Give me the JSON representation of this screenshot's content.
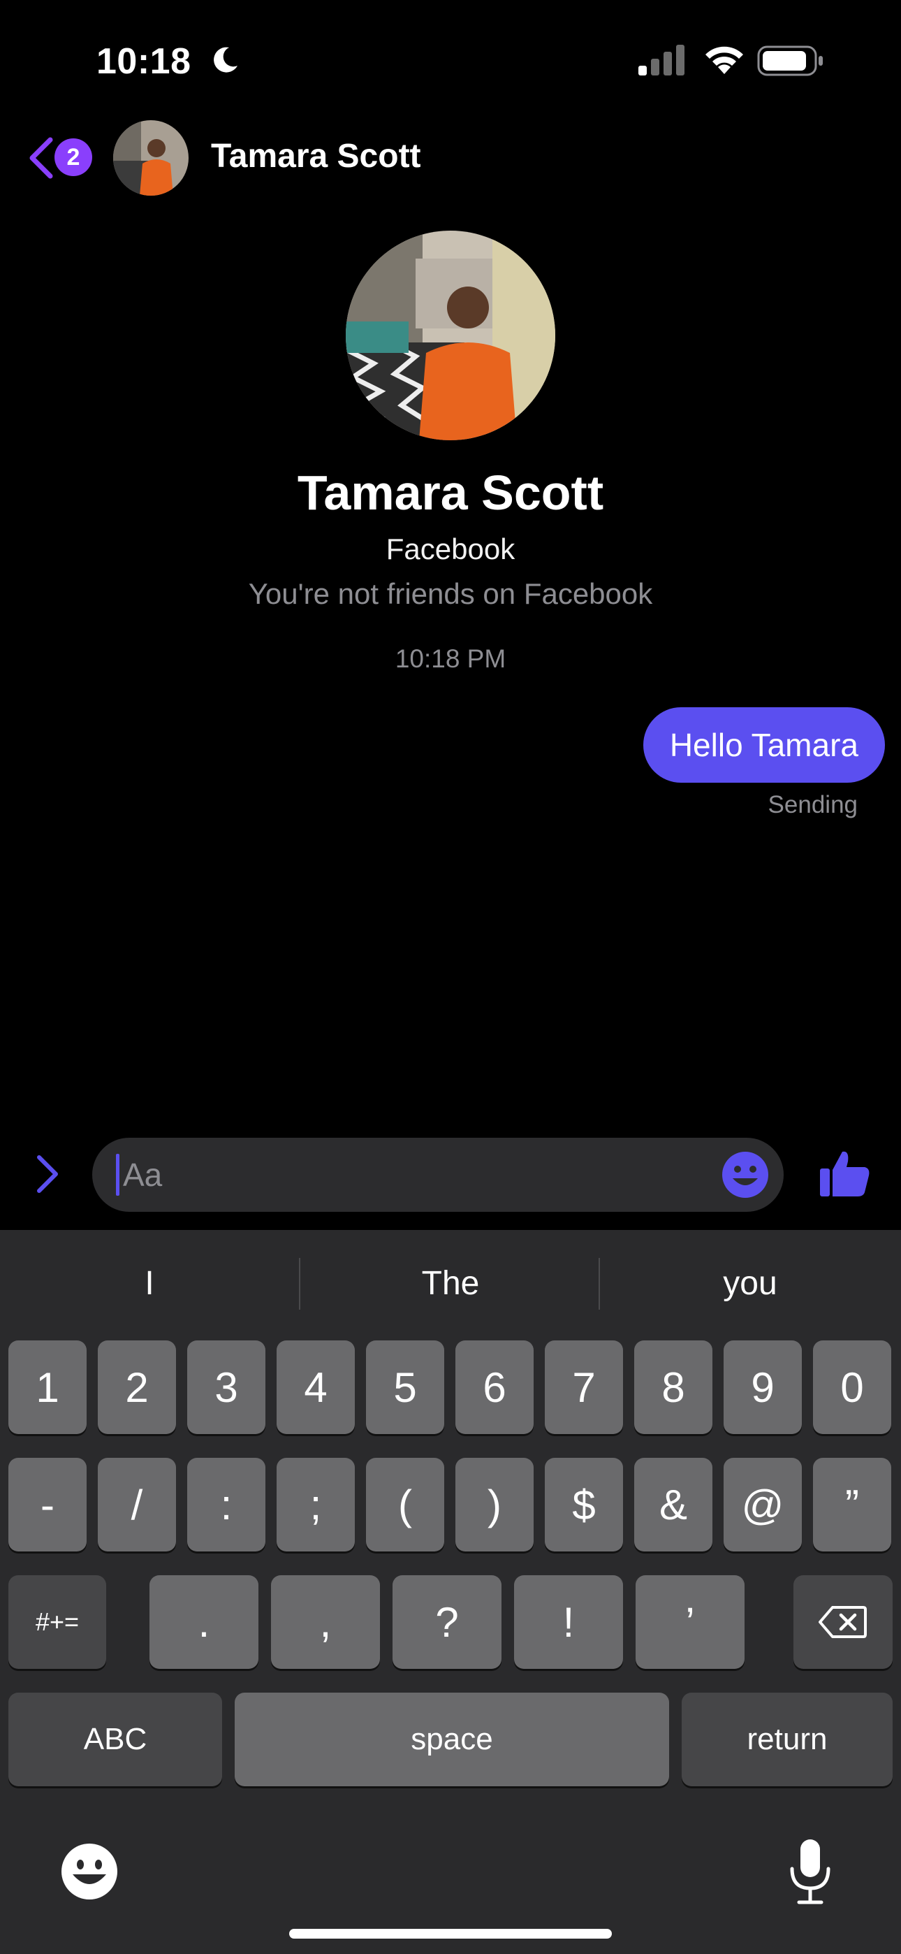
{
  "status_bar": {
    "time": "10:18"
  },
  "header": {
    "unread_count": "2",
    "contact_name": "Tamara Scott"
  },
  "profile": {
    "name": "Tamara Scott",
    "network": "Facebook",
    "friend_status": "You're not friends on Facebook"
  },
  "conversation": {
    "timestamp": "10:18 PM",
    "messages": [
      {
        "text": "Hello Tamara",
        "status": "Sending"
      }
    ]
  },
  "composer": {
    "placeholder": "Aa"
  },
  "keyboard": {
    "suggestions": [
      "I",
      "The",
      "you"
    ],
    "row1": [
      "1",
      "2",
      "3",
      "4",
      "5",
      "6",
      "7",
      "8",
      "9",
      "0"
    ],
    "row2": [
      "-",
      "/",
      ":",
      ";",
      "(",
      ")",
      "$",
      "&",
      "@",
      "”"
    ],
    "row3": [
      ".",
      ",",
      "?",
      "!",
      "’"
    ],
    "symbols_key": "#+=",
    "abc_key": "ABC",
    "space_key": "space",
    "return_key": "return"
  },
  "colors": {
    "accent": "#5b4ff0",
    "badge": "#8a3ffc",
    "keyboard_bg": "#2a2a2c"
  },
  "icons": [
    "moon-icon",
    "signal-icon",
    "wifi-icon",
    "battery-icon",
    "back-chevron-icon",
    "expand-chevron-icon",
    "emoji-icon",
    "thumbs-up-icon",
    "backspace-icon",
    "mic-icon"
  ]
}
